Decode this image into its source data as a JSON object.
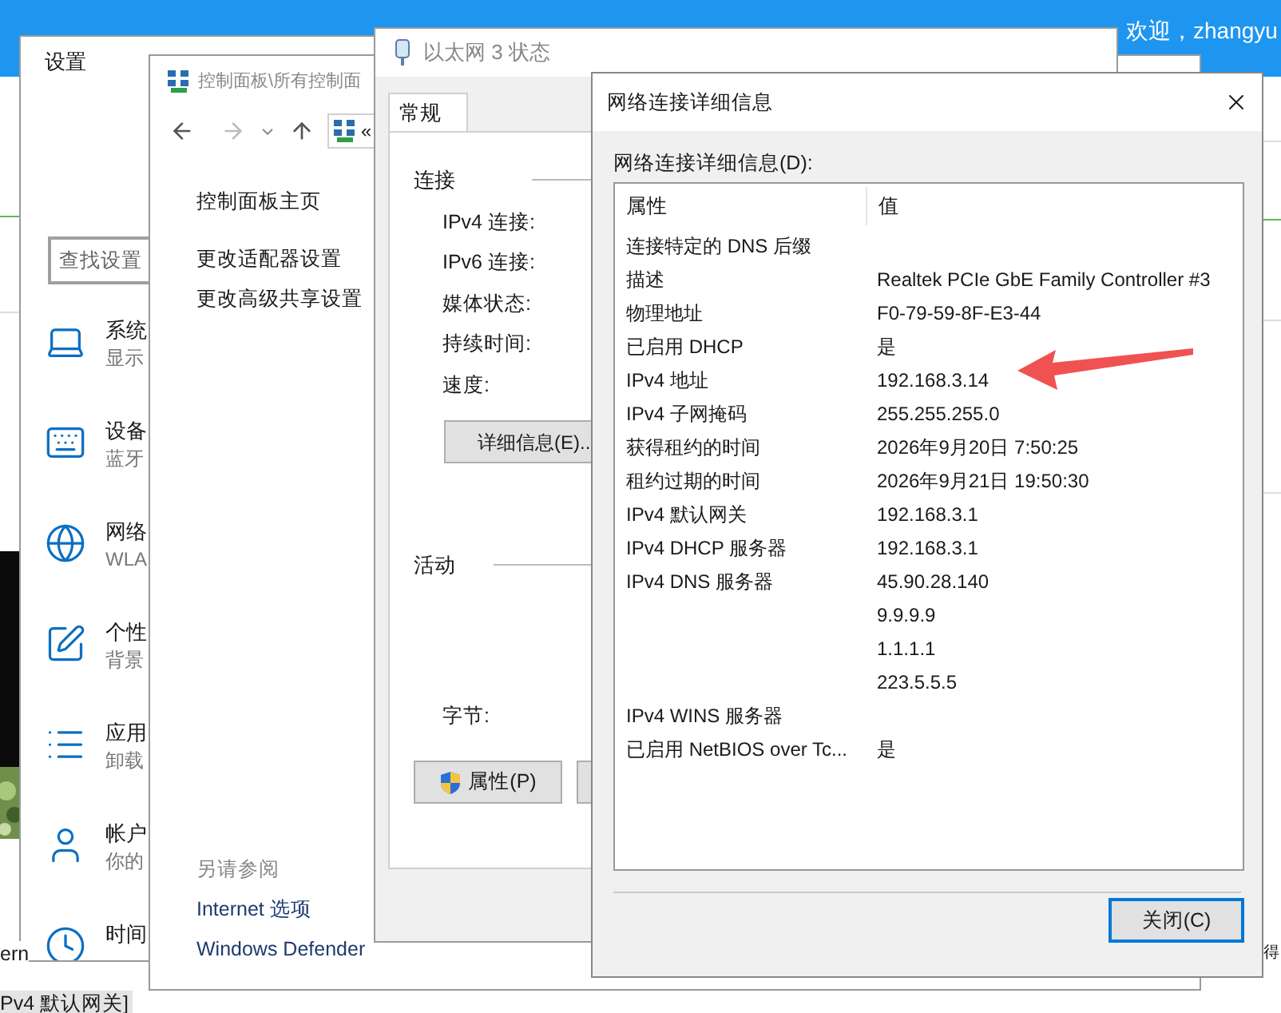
{
  "browser_header": {
    "greeting": "欢迎，zhangyu"
  },
  "background_texts": [
    "ern",
    "得"
  ],
  "tooltip": "Pv4 默认网关]",
  "settings": {
    "title": "设置",
    "search": {
      "placeholder": "查找设置"
    },
    "items": [
      {
        "kind": "laptop",
        "title": "系统",
        "subtitle": "显示"
      },
      {
        "kind": "device",
        "title": "设备",
        "subtitle": "蓝牙"
      },
      {
        "kind": "globe",
        "title": "网络",
        "subtitle": "WLA"
      },
      {
        "kind": "personalize",
        "title": "个性",
        "subtitle": "背景"
      },
      {
        "kind": "apps",
        "title": "应用",
        "subtitle": "卸载"
      },
      {
        "kind": "account",
        "title": "帐户",
        "subtitle": "你的"
      },
      {
        "kind": "time",
        "title": "时间"
      }
    ]
  },
  "control_panel": {
    "title": "控制面板\\所有控制面",
    "address": "«",
    "links": [
      "控制面板主页",
      "更改适配器设置",
      "更改高级共享设置"
    ],
    "see_also": {
      "heading": "另请参阅",
      "links": [
        "Internet 选项",
        "Windows Defender"
      ]
    }
  },
  "status": {
    "title": "以太网 3 状态",
    "tabs": [
      {
        "label": "常规",
        "selected": true
      }
    ],
    "connection": {
      "heading": "连接",
      "fields": [
        "IPv4 连接:",
        "IPv6 连接:",
        "媒体状态:",
        "持续时间:",
        "速度:"
      ]
    },
    "details_button": "详细信息(E)..",
    "activity": {
      "heading": "活动",
      "bytes_label": "字节:"
    },
    "properties_button": "属性(P)"
  },
  "details": {
    "title": "网络连接详细信息",
    "list_label": "网络连接详细信息(D):",
    "columns": [
      "属性",
      "值"
    ],
    "rows": [
      {
        "property": "连接特定的 DNS 后缀"
      },
      {
        "property": "描述",
        "value": "Realtek PCIe GbE Family Controller #3"
      },
      {
        "property": "物理地址",
        "value": "F0-79-59-8F-E3-44"
      },
      {
        "property": "已启用 DHCP",
        "value": "是"
      },
      {
        "property": "IPv4 地址",
        "value": "192.168.3.14"
      },
      {
        "property": "IPv4 子网掩码",
        "value": "255.255.255.0"
      },
      {
        "property": "获得租约的时间",
        "value": "2026年9月20日 7:50:25"
      },
      {
        "property": "租约过期的时间",
        "value": "2026年9月21日 19:50:30"
      },
      {
        "property": "IPv4 默认网关",
        "value": "192.168.3.1"
      },
      {
        "property": "IPv4 DHCP 服务器",
        "value": "192.168.3.1"
      },
      {
        "property": "IPv4 DNS 服务器",
        "value": "45.90.28.140"
      },
      {
        "value": "9.9.9.9"
      },
      {
        "value": "1.1.1.1"
      },
      {
        "value": "223.5.5.5"
      },
      {
        "property": "IPv4 WINS 服务器"
      },
      {
        "property": "已启用 NetBIOS over Tc...",
        "value": "是"
      }
    ],
    "close_button": "关闭(C)"
  }
}
